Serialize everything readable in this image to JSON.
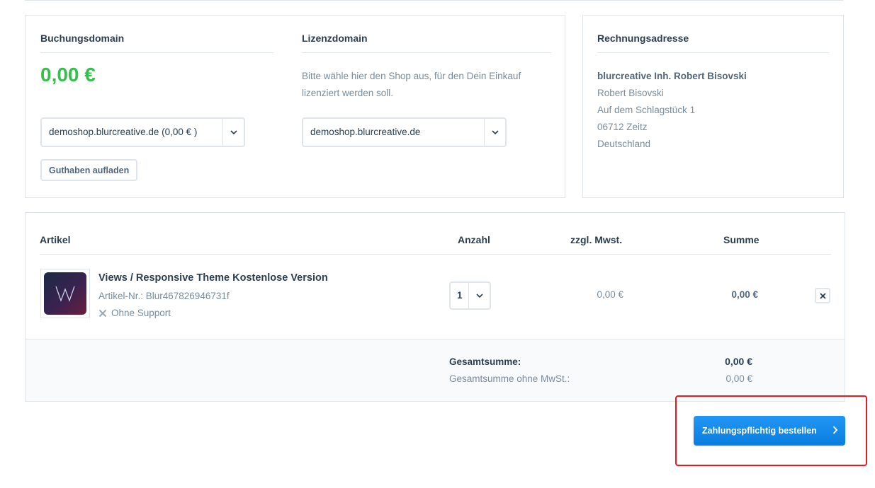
{
  "booking": {
    "title": "Buchungsdomain",
    "amount": "0,00 €",
    "domain_select": "demoshop.blurcreative.de (0,00 € )",
    "topup_button": "Guthaben aufladen"
  },
  "license": {
    "title": "Lizenzdomain",
    "hint": "Bitte wähle hier den Shop aus, für den Dein Einkauf lizenziert werden soll.",
    "domain_select": "demoshop.blurcreative.de"
  },
  "billing": {
    "title": "Rechnungsadresse",
    "company": "blurcreative Inh. Robert Bisovski",
    "name": "Robert Bisovski",
    "street": "Auf dem Schlagstück 1",
    "city": "06712 Zeitz",
    "country": "Deutschland"
  },
  "cart": {
    "headers": {
      "article": "Artikel",
      "quantity": "Anzahl",
      "tax": "zzgl. Mwst.",
      "sum": "Summe"
    },
    "item": {
      "name": "Views / Responsive Theme Kostenlose Version",
      "sku": "Artikel-Nr.: Blur467826946731f",
      "support": "Ohne Support",
      "quantity": "1",
      "tax": "0,00 €",
      "sum": "0,00 €",
      "thumb_letter": "W"
    },
    "totals": {
      "total_label": "Gesamtsumme:",
      "total_value": "0,00 €",
      "net_label": "Gesamtsumme ohne MwSt.:",
      "net_value": "0,00 €"
    }
  },
  "order_button": "Zahlungspflichtig bestellen",
  "colors": {
    "accent": "#1a8ae9",
    "amount_green": "#37bf4e",
    "highlight_red": "#e41b23"
  }
}
